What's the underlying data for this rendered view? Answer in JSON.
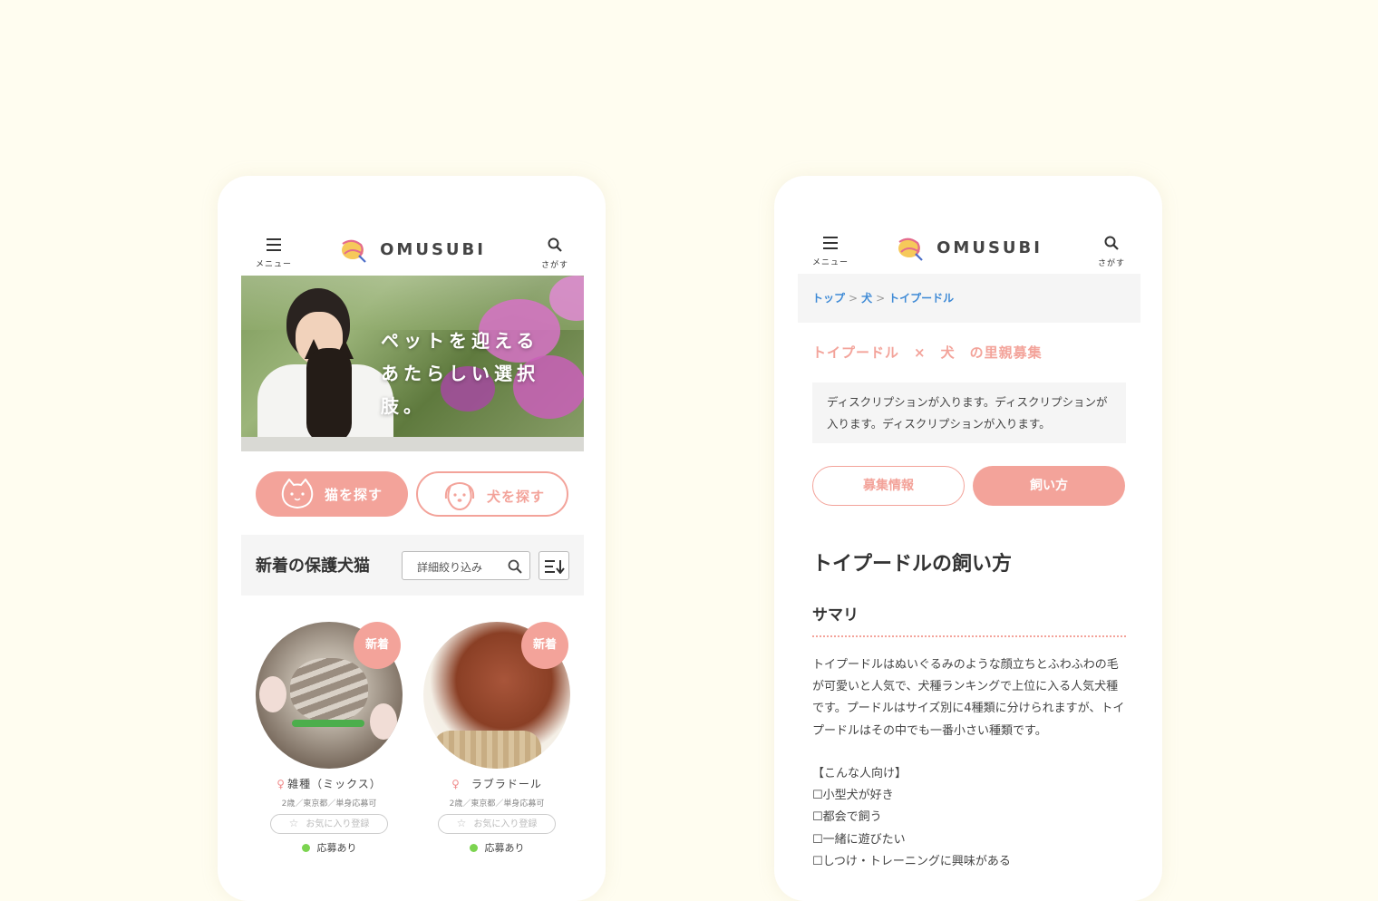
{
  "brand": "OMUSUBI",
  "header": {
    "menu_label": "メニュー",
    "search_label": "さがす"
  },
  "home": {
    "hero_copy": [
      "ペットを迎える",
      "あたらしい選択肢。"
    ],
    "find_cat": "猫を探す",
    "find_dog": "犬を探す",
    "new_arrivals_title": "新着の保護犬猫",
    "filter_label": "詳細絞り込み",
    "cards": [
      {
        "badge": "新着",
        "sex": "♀",
        "breed": "雑種（ミックス）",
        "meta": "2歳／東京都／単身応募可",
        "favorite": "お気に入り登録",
        "status": "応募あり"
      },
      {
        "badge": "新着",
        "sex": "♀",
        "breed": "ラブラドール",
        "meta": "2歳／東京都／単身応募可",
        "favorite": "お気に入り登録",
        "status": "応募あり"
      }
    ]
  },
  "detail": {
    "breadcrumb": [
      "トップ",
      "犬",
      "トイプードル"
    ],
    "breadcrumb_sep": ">",
    "page_title": "トイプードル　×　犬　の里親募集",
    "description": "ディスクリプションが入ります。ディスクリプションが入ります。ディスクリプションが入ります。",
    "tab_recruit": "募集情報",
    "tab_howto": "飼い方",
    "heading": "トイプードルの飼い方",
    "subheading": "サマリ",
    "summary": "トイプードルはぬいぐるみのような顔立ちとふわふわの毛が可愛いと人気で、犬種ランキングで上位に入る人気犬種です。プードルはサイズ別に4種類に分けられますが、トイプードルはその中でも一番小さい種類です。",
    "recommended_title": "【こんな人向け】",
    "recommended": [
      "☐小型犬が好き",
      "☐都会で飼う",
      "☐一緒に遊びたい",
      "☐しつけ・トレーニングに興味がある"
    ]
  },
  "colors": {
    "accent": "#f3a39a",
    "link": "#3e8ad6",
    "status_dot": "#7cd450",
    "background": "#fffdf0"
  }
}
